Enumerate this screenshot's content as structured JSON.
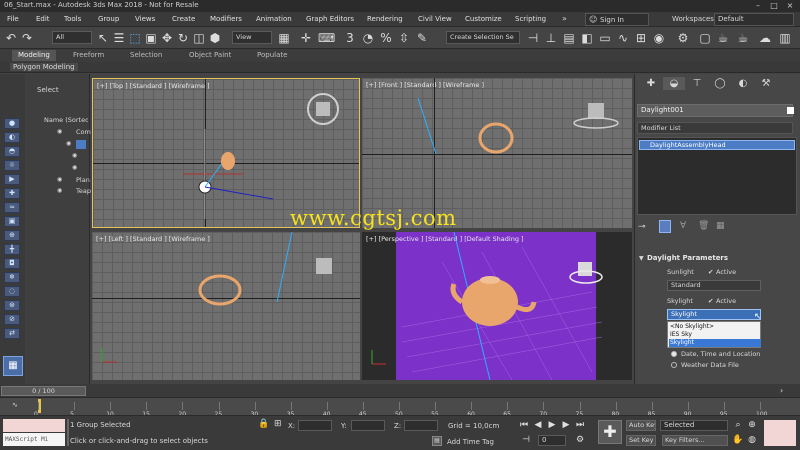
{
  "window": {
    "title": "06_Start.max - Autodesk 3ds Max 2018 - Not for Resale"
  },
  "menu": [
    "File",
    "Edit",
    "Tools",
    "Group",
    "Views",
    "Create",
    "Modifiers",
    "Animation",
    "Graph Editors",
    "Rendering",
    "Civil View",
    "Customize",
    "Scripting"
  ],
  "account": {
    "signin": "Sign In",
    "workspaces_label": "Workspaces:",
    "workspace": "Default"
  },
  "toolbar": {
    "filter": "All",
    "refcoord": "View",
    "selection_set": "Create Selection Se"
  },
  "ribbon": {
    "tabs": [
      "Modeling",
      "Freeform",
      "Selection",
      "Object Paint",
      "Populate"
    ],
    "sub": "Polygon Modeling"
  },
  "scene": {
    "header": "Select",
    "column": "Name (Sorted A",
    "rows": [
      "Com",
      "",
      "",
      "",
      "Plan",
      "Teap"
    ]
  },
  "viewports": {
    "top": "[+] [Top ] [Standard ] [Wireframe ]",
    "front": "[+] [Front ] [Standard ] [Wireframe ]",
    "left": "[+] [Left ] [Standard ] [Wireframe ]",
    "perspective": "[+] [Perspective ] [Standard ] [Default Shading ]"
  },
  "watermark": "www.cgtsj.com",
  "command_panel": {
    "object_name": "Daylight001",
    "modifier_list": "Modifier List",
    "stack_item": "DaylightAssemblyHead",
    "rollout": "Daylight Parameters",
    "sunlight_label": "Sunlight",
    "sunlight_active": "Active",
    "sunlight_type": "Standard",
    "skylight_label": "Skylight",
    "skylight_active": "Active",
    "skylight_type": "Skylight",
    "skylight_options": [
      "<No Skylight>",
      "IES Sky",
      "Skylight"
    ],
    "position_opt1": "Date, Time and Location",
    "position_opt2": "Weather Data File"
  },
  "timeline": {
    "frame": "0 / 100",
    "ticks": [
      "0",
      "5",
      "10",
      "15",
      "20",
      "25",
      "30",
      "35",
      "40",
      "45",
      "50",
      "55",
      "60",
      "65",
      "70",
      "75",
      "80",
      "85",
      "90",
      "95",
      "100"
    ]
  },
  "status": {
    "maxscript": "MAXScript Mi",
    "selection": "1 Group Selected",
    "prompt": "Click or click-and-drag to select objects",
    "x_label": "X:",
    "y_label": "Y:",
    "z_label": "Z:",
    "grid": "Grid = 10,0cm",
    "add_time_tag": "Add Time Tag",
    "frame_field": "0",
    "auto_key": "Auto Key",
    "set_key": "Set Key",
    "selected": "Selected",
    "key_filters": "Key Filters..."
  },
  "colors": {
    "accent": "#4b7cc4",
    "perspective_bg": "#7c31c8",
    "watermark": "#f7e21c",
    "teapot": "#e8a66c"
  }
}
